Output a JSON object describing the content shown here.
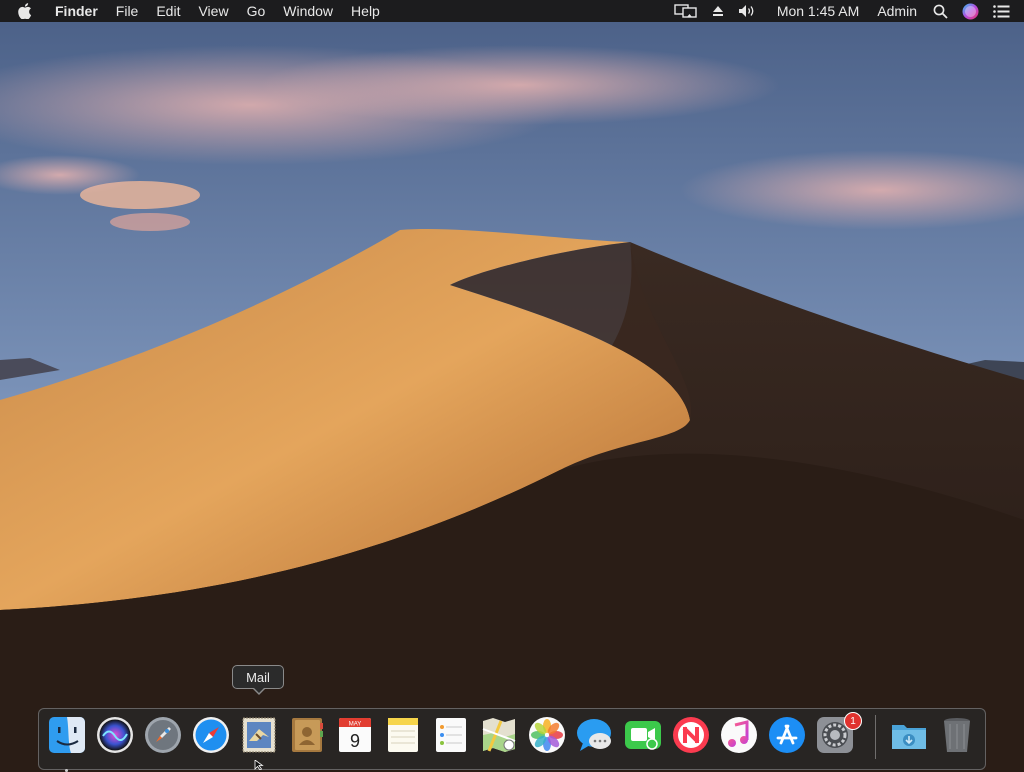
{
  "menubar": {
    "app_name": "Finder",
    "menus": [
      "File",
      "Edit",
      "View",
      "Go",
      "Window",
      "Help"
    ],
    "clock": "Mon 1:45 AM",
    "user": "Admin"
  },
  "tooltip": {
    "text": "Mail"
  },
  "dock": {
    "apps": [
      {
        "name": "Finder",
        "icon": "finder-icon",
        "running": true
      },
      {
        "name": "Siri",
        "icon": "siri-icon"
      },
      {
        "name": "Launchpad",
        "icon": "launchpad-icon"
      },
      {
        "name": "Safari",
        "icon": "safari-icon"
      },
      {
        "name": "Mail",
        "icon": "mail-icon"
      },
      {
        "name": "Contacts",
        "icon": "contacts-icon"
      },
      {
        "name": "Calendar",
        "icon": "calendar-icon",
        "month": "MAY",
        "day": "9"
      },
      {
        "name": "Notes",
        "icon": "notes-icon"
      },
      {
        "name": "Reminders",
        "icon": "reminders-icon"
      },
      {
        "name": "Maps",
        "icon": "maps-icon"
      },
      {
        "name": "Photos",
        "icon": "photos-icon"
      },
      {
        "name": "Messages",
        "icon": "messages-icon"
      },
      {
        "name": "FaceTime",
        "icon": "facetime-icon"
      },
      {
        "name": "News",
        "icon": "news-icon"
      },
      {
        "name": "iTunes",
        "icon": "itunes-icon"
      },
      {
        "name": "App Store",
        "icon": "app-store-icon"
      },
      {
        "name": "System Preferences",
        "icon": "system-preferences-icon",
        "badge": "1"
      },
      {
        "name": "Downloads",
        "icon": "downloads-folder-icon"
      },
      {
        "name": "Trash",
        "icon": "trash-icon"
      }
    ]
  },
  "colors": {
    "menubar_bg": "#1c1c1e",
    "sky_top": "#4a5f86",
    "sky_bottom": "#8aa3c7",
    "dune_light": "#d4934a",
    "dune_shadow": "#2c1f18",
    "badge_red": "#e0322e"
  }
}
